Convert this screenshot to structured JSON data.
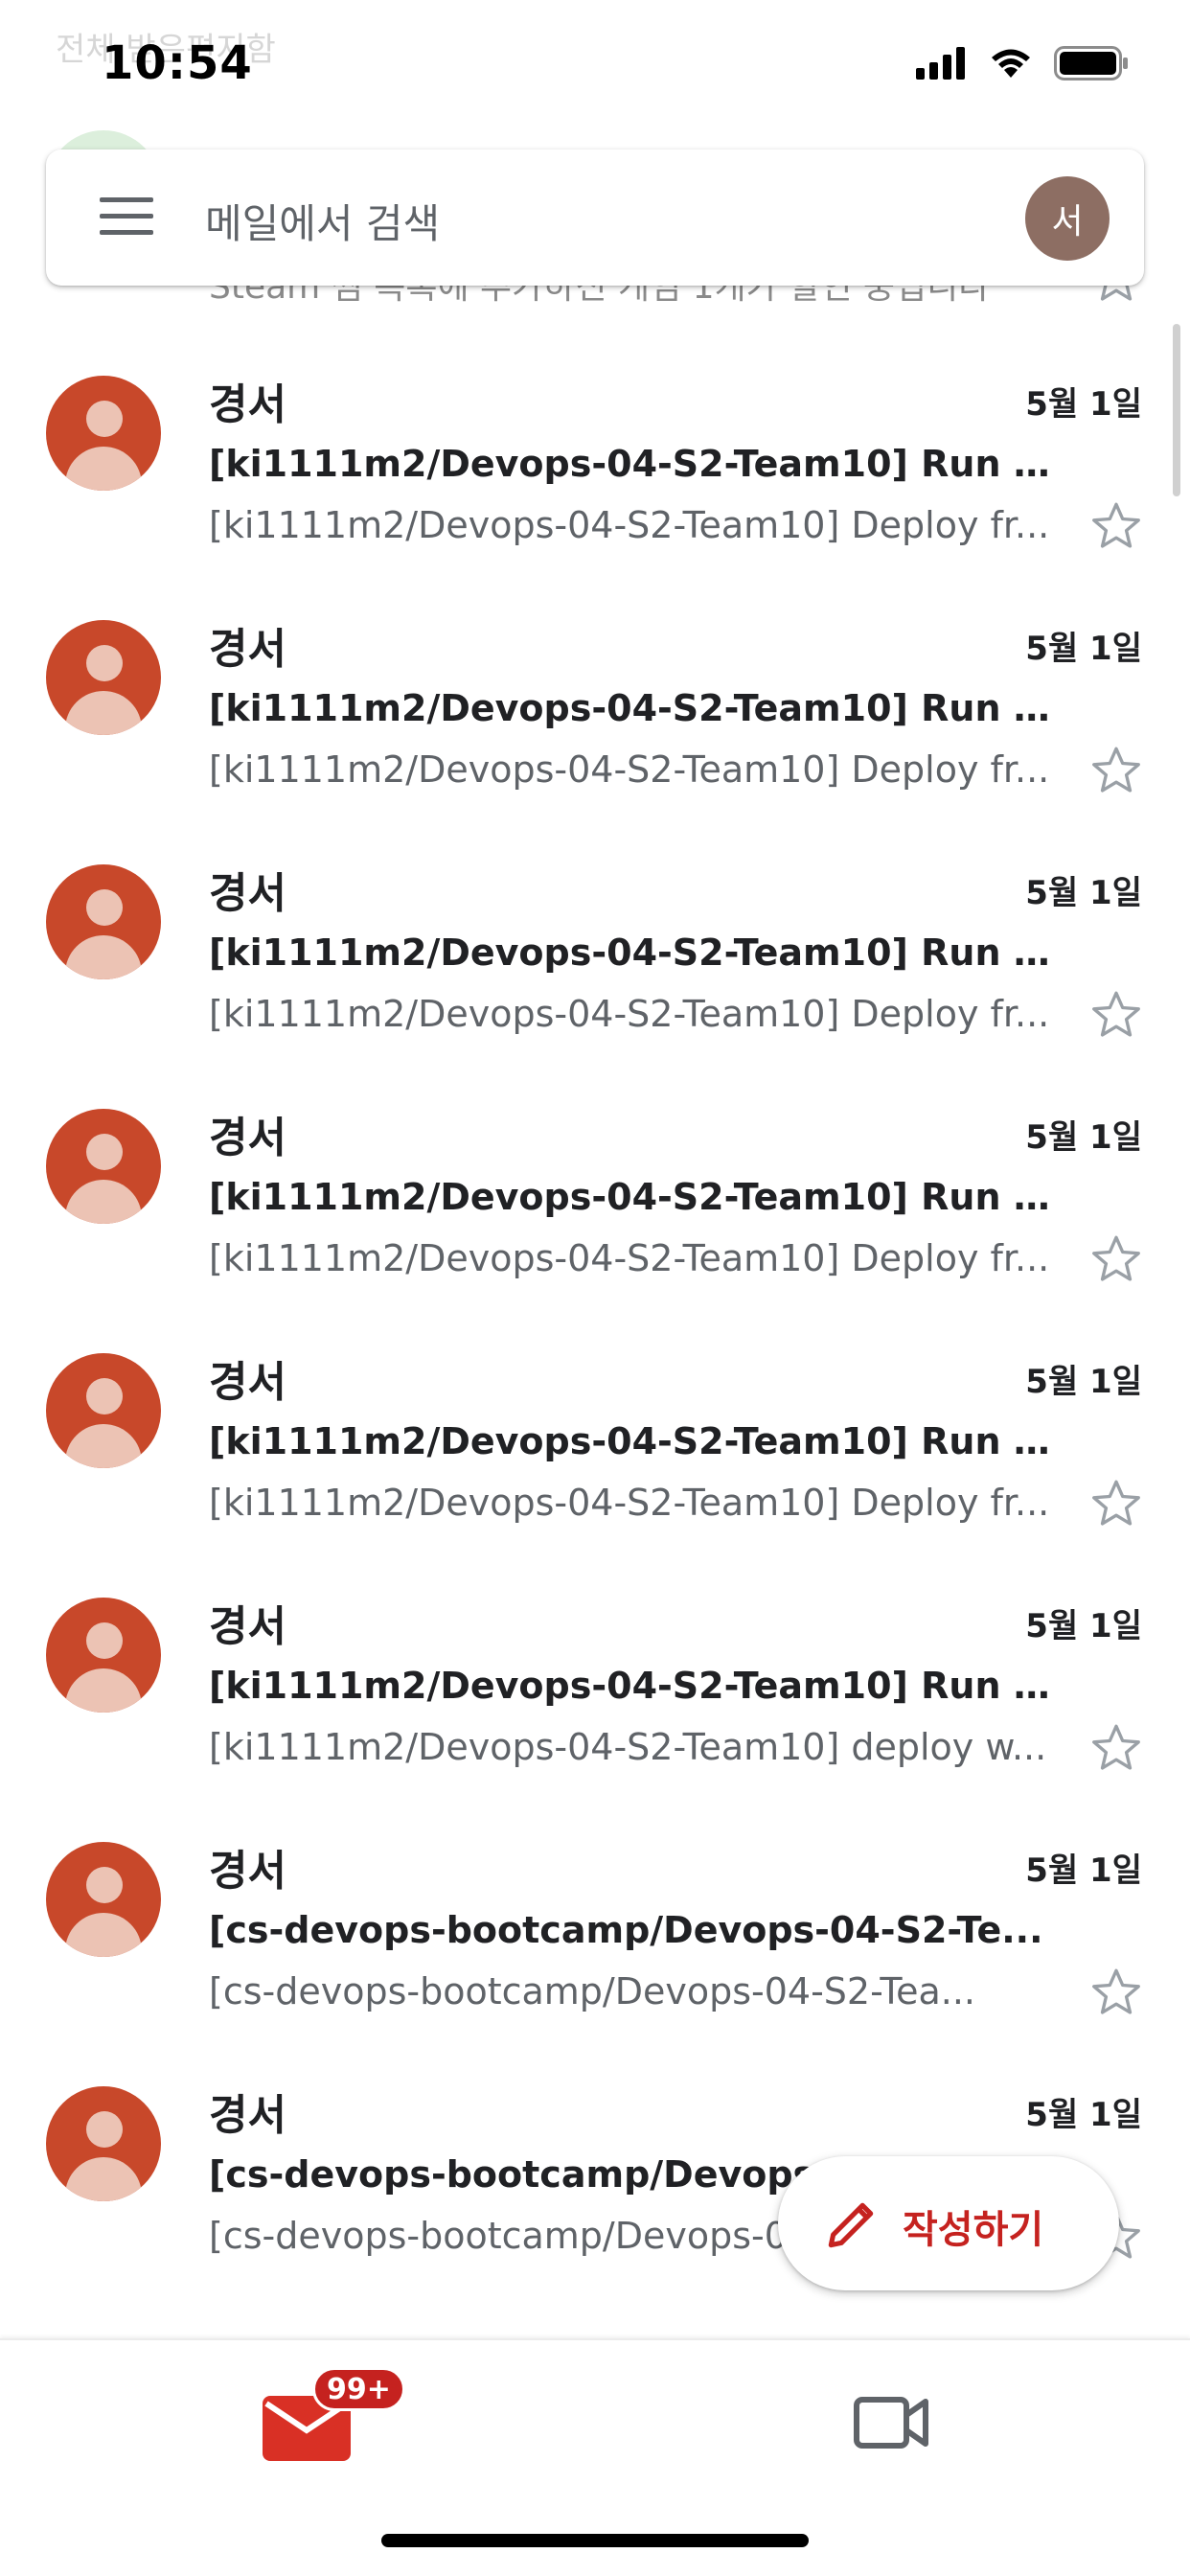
{
  "status_bar": {
    "time": "10:54",
    "behind_label": "전체 받은편지함"
  },
  "search": {
    "placeholder": "메일에서 검색",
    "account_initial": "서"
  },
  "peek_row": {
    "snippet": "Steam 찜 목록에 추가하신 게임 1개가 할인 중입니다"
  },
  "emails": [
    {
      "sender": "경서",
      "date": "5월 1일",
      "subject": "[ki1111m2/Devops-04-S2-Team10] Run f...",
      "snippet": "[ki1111m2/Devops-04-S2-Team10] Deploy fr...",
      "starred": false
    },
    {
      "sender": "경서",
      "date": "5월 1일",
      "subject": "[ki1111m2/Devops-04-S2-Team10] Run f...",
      "snippet": "[ki1111m2/Devops-04-S2-Team10] Deploy fr...",
      "starred": false
    },
    {
      "sender": "경서",
      "date": "5월 1일",
      "subject": "[ki1111m2/Devops-04-S2-Team10] Run f...",
      "snippet": "[ki1111m2/Devops-04-S2-Team10] Deploy fr...",
      "starred": false
    },
    {
      "sender": "경서",
      "date": "5월 1일",
      "subject": "[ki1111m2/Devops-04-S2-Team10] Run f...",
      "snippet": "[ki1111m2/Devops-04-S2-Team10] Deploy fr...",
      "starred": false
    },
    {
      "sender": "경서",
      "date": "5월 1일",
      "subject": "[ki1111m2/Devops-04-S2-Team10] Run f...",
      "snippet": "[ki1111m2/Devops-04-S2-Team10] Deploy fr...",
      "starred": false
    },
    {
      "sender": "경서",
      "date": "5월 1일",
      "subject": "[ki1111m2/Devops-04-S2-Team10] Run f...",
      "snippet": "[ki1111m2/Devops-04-S2-Team10] deploy w...",
      "starred": false
    },
    {
      "sender": "경서",
      "date": "5월 1일",
      "subject": "[cs-devops-bootcamp/Devops-04-S2-Te...",
      "snippet": "[cs-devops-bootcamp/Devops-04-S2-Tea...",
      "starred": false
    },
    {
      "sender": "경서",
      "date": "5월 1일",
      "subject": "[cs-devops-bootcamp/Devops-04-S2-Te...",
      "snippet": "[cs-devops-bootcamp/Devops-04-S2-Tea...",
      "starred": false
    }
  ],
  "compose": {
    "label": "작성하기"
  },
  "bottom_nav": {
    "mail_badge": "99+"
  },
  "colors": {
    "avatar_bg": "#c8482a",
    "accent_red": "#c5221f",
    "account_avatar": "#8d6e63"
  },
  "icons": {
    "menu": "menu-icon",
    "star": "star-outline-icon",
    "compose": "pencil-icon",
    "mail": "mail-icon",
    "meet": "video-camera-icon"
  }
}
